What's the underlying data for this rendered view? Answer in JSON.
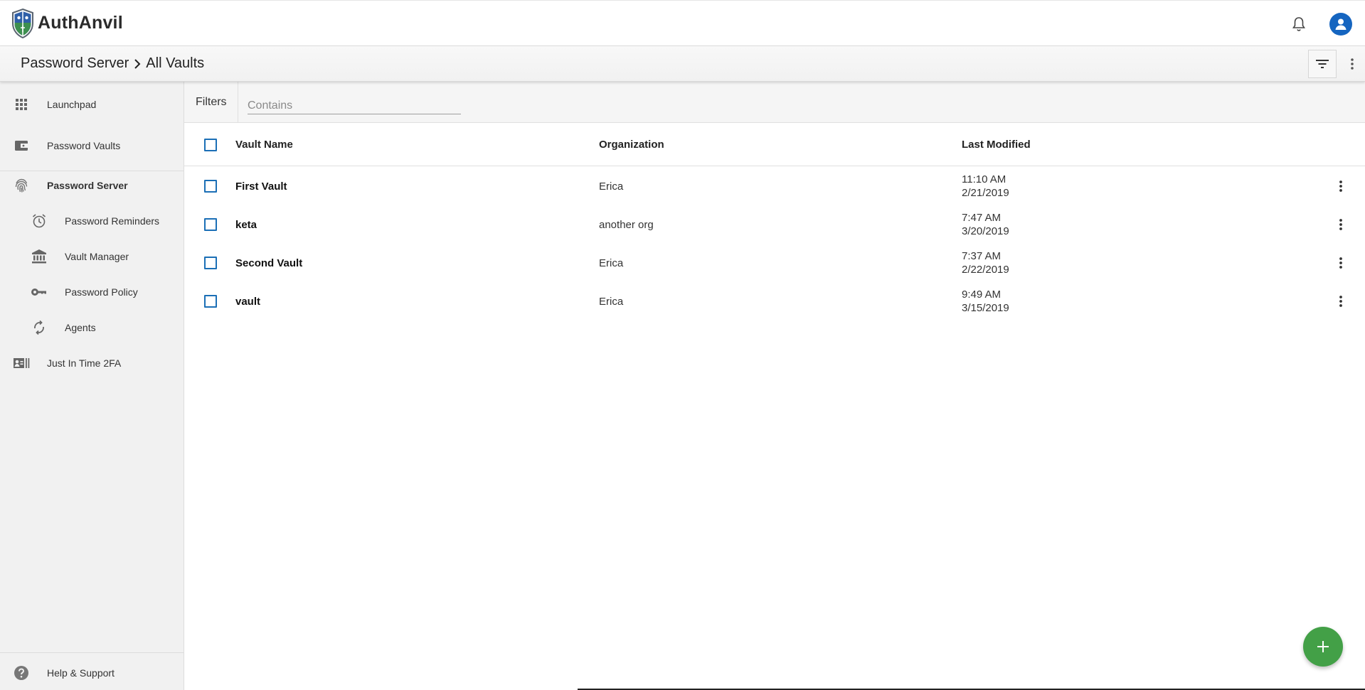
{
  "header": {
    "app_name": "AuthAnvil",
    "accent": "#1565c0"
  },
  "breadcrumb": {
    "parent": "Password Server",
    "current": "All Vaults"
  },
  "sidebar": {
    "items": [
      {
        "label": "Launchpad",
        "icon": "apps-grid-icon"
      },
      {
        "label": "Password Vaults",
        "icon": "wallet-icon"
      },
      {
        "label": "Password Server",
        "icon": "fingerprint-icon",
        "active": true
      },
      {
        "label": "Password Reminders",
        "icon": "alarm-clock-icon"
      },
      {
        "label": "Vault Manager",
        "icon": "bank-icon"
      },
      {
        "label": "Password Policy",
        "icon": "key-icon"
      },
      {
        "label": "Agents",
        "icon": "sync-icon"
      },
      {
        "label": "Just In Time 2FA",
        "icon": "id-card-icon"
      }
    ],
    "help_label": "Help & Support"
  },
  "filters": {
    "label": "Filters",
    "placeholder": "Contains",
    "value": ""
  },
  "table": {
    "columns": {
      "name": "Vault Name",
      "org": "Organization",
      "modified": "Last Modified"
    },
    "rows": [
      {
        "name": "First Vault",
        "org": "Erica",
        "time": "11:10 AM",
        "date": "2/21/2019"
      },
      {
        "name": "keta",
        "org": "another org",
        "time": "7:47 AM",
        "date": "3/20/2019"
      },
      {
        "name": "Second Vault",
        "org": "Erica",
        "time": "7:37 AM",
        "date": "2/22/2019"
      },
      {
        "name": "vault",
        "org": "Erica",
        "time": "9:49 AM",
        "date": "3/15/2019"
      }
    ]
  },
  "fab": {
    "icon": "plus-icon",
    "color": "#43a047"
  }
}
